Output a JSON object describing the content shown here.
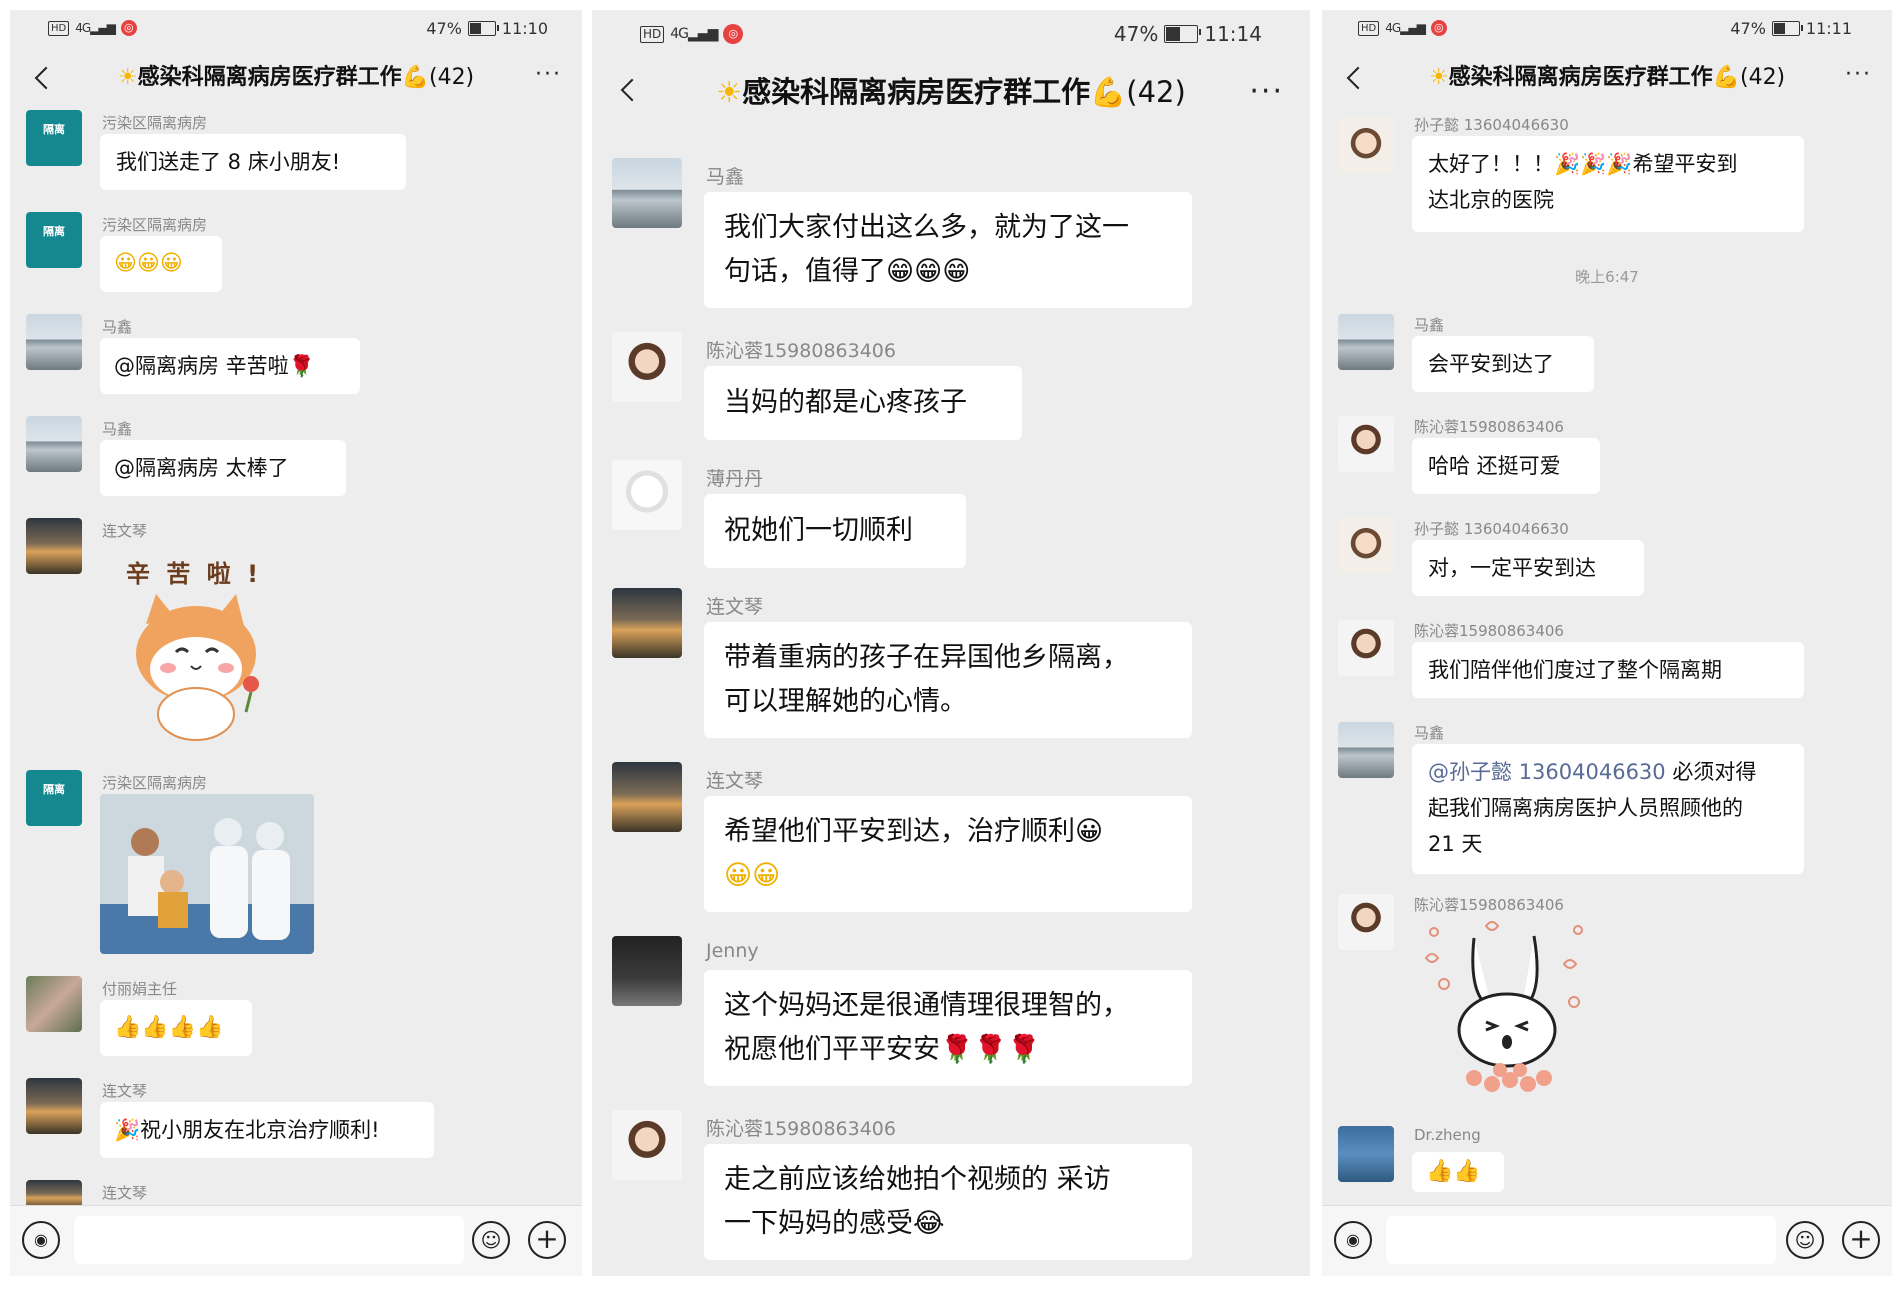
{
  "screens": [
    {
      "status": {
        "left": "HD",
        "signal": "4G",
        "battery": "47%",
        "time": "11:10"
      },
      "title": {
        "prefix": "☀",
        "name": "感染科隔离病房医疗群工作",
        "arm": "💪",
        "count": "(42)"
      },
      "messages": [
        {
          "avatar": "隔离",
          "nick": "污染区隔离病房",
          "text": "我们送走了 8 床小朋友!"
        },
        {
          "avatar": "隔离",
          "nick": "污染区隔离病房",
          "text": "😀😀😀"
        },
        {
          "nick": "马鑫",
          "text": "@隔离病房  辛苦啦🌹"
        },
        {
          "nick": "马鑫",
          "text": "@隔离病房  太棒了"
        },
        {
          "nick": "连文琴",
          "sticker_text": "辛 苦 啦 !"
        },
        {
          "avatar": "隔离",
          "nick": "污染区隔离病房"
        },
        {
          "nick": "付丽娟主任",
          "text": "👍👍👍👍"
        },
        {
          "nick": "连文琴",
          "text": "🎉祝小朋友在北京治疗顺利!"
        },
        {
          "nick": "连文琴"
        }
      ],
      "input": {
        "voice": "◉",
        "emoji": "☺",
        "plus": "+"
      }
    },
    {
      "status": {
        "left": "HD",
        "signal": "4G",
        "battery": "47%",
        "time": "11:14"
      },
      "title": {
        "prefix": "☀",
        "name": "感染科隔离病房医疗群工作",
        "arm": "💪",
        "count": "(42)"
      },
      "messages": [
        {
          "nick": "马鑫",
          "line1": "我们大家付出这么多，就为了这一",
          "line2": "句话，值得了😁😁😁"
        },
        {
          "nick": "陈沁蓉15980863406",
          "line1": "当妈的都是心疼孩子"
        },
        {
          "nick": "薄丹丹",
          "line1": "祝她们一切顺利"
        },
        {
          "nick": "连文琴",
          "line1": "带着重病的孩子在异国他乡隔离，",
          "line2": "可以理解她的心情。"
        },
        {
          "nick": "连文琴",
          "line1": "希望他们平安到达，治疗顺利😀",
          "line2": "😀😀"
        },
        {
          "nick": "Jenny",
          "line1": "这个妈妈还是很通情理很理智的，",
          "line2": "祝愿他们平平安安🌹🌹🌹"
        },
        {
          "nick": "陈沁蓉15980863406",
          "line1": "走之前应该给她拍个视频的 采访",
          "line2": "一下妈妈的感受😂"
        }
      ]
    },
    {
      "status": {
        "left": "HD",
        "signal": "4G",
        "battery": "47%",
        "time": "11:11"
      },
      "title": {
        "prefix": "☀",
        "name": "感染科隔离病房医疗群工作",
        "arm": "💪",
        "count": "(42)"
      },
      "messages": [
        {
          "nick": "孙子懿 13604046630",
          "line1": "太好了！！！🎉🎉🎉希望平安到",
          "line2": "达北京的医院"
        },
        {
          "nick": "马鑫",
          "line1": "会平安到达了"
        },
        {
          "nick": "陈沁蓉15980863406",
          "line1": "哈哈 还挺可爱"
        },
        {
          "nick": "孙子懿 13604046630",
          "line1": "对，一定平安到达"
        },
        {
          "nick": "陈沁蓉15980863406",
          "line1": "我们陪伴他们度过了整个隔离期"
        },
        {
          "nick": "马鑫",
          "mention": "@孙子懿",
          "mention_num": "13604046630",
          "after": " 必须对得",
          "line2": "起我们隔离病房医护人员照顾他的",
          "line3": "21 天"
        },
        {
          "nick": "陈沁蓉15980863406"
        },
        {
          "nick": "Dr.zheng",
          "line1": "👍👍"
        }
      ],
      "timestamp": "晚上6:47",
      "input": {
        "voice": "◉",
        "emoji": "☺",
        "plus": "+"
      }
    }
  ]
}
